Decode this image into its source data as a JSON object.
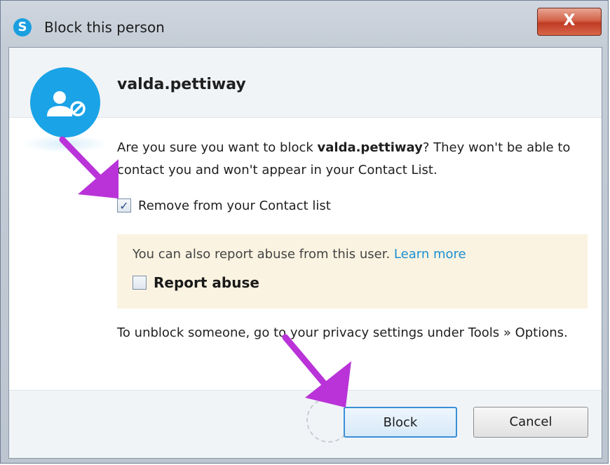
{
  "window": {
    "title": "Block this person",
    "app_icon": "skype-icon",
    "close_label": "X"
  },
  "contact": {
    "username": "valda.pettiway",
    "avatar_icon": "blocked-user-icon"
  },
  "message": {
    "prefix": "Are you sure you want to block ",
    "username": "valda.pettiway",
    "suffix": "? They won't be able to contact you and won't appear in your Contact List."
  },
  "remove_option": {
    "label": "Remove from your Contact list",
    "checked": true,
    "check_glyph": "✓"
  },
  "report": {
    "text": "You can also report abuse from this user. ",
    "learn_more": "Learn more",
    "checkbox_label": "Report abuse",
    "checked": false
  },
  "unblock_info": "To unblock someone, go to your privacy settings under Tools » Options.",
  "buttons": {
    "block": "Block",
    "cancel": "Cancel"
  },
  "colors": {
    "accent": "#1aa3e6",
    "link": "#1b8fd0",
    "arrow": "#b933d8",
    "report_bg": "#fbf3e1"
  }
}
